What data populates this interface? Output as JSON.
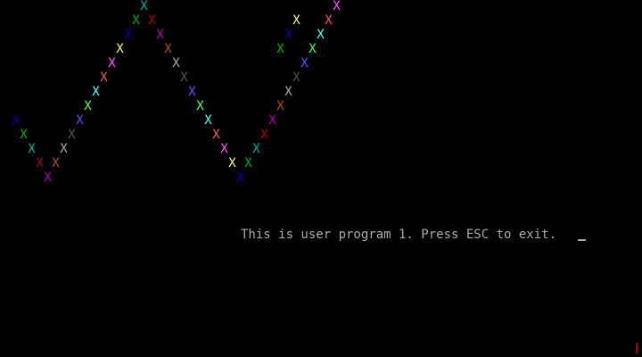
{
  "screen": {
    "message": "This is user program 1. Press ESC to exit.",
    "background_color": "#000000",
    "text_color": "#aaaaaa"
  },
  "pattern": {
    "glyph": "X",
    "marks": [
      {
        "col": 1,
        "row": 8,
        "color": "#0000aa"
      },
      {
        "col": 2,
        "row": 9,
        "color": "#00aa00"
      },
      {
        "col": 3,
        "row": 10,
        "color": "#00aaaa"
      },
      {
        "col": 4,
        "row": 11,
        "color": "#aa0000"
      },
      {
        "col": 5,
        "row": 12,
        "color": "#aa00aa"
      },
      {
        "col": 6,
        "row": 11,
        "color": "#aa5500"
      },
      {
        "col": 7,
        "row": 10,
        "color": "#aaaaaa"
      },
      {
        "col": 8,
        "row": 9,
        "color": "#555555"
      },
      {
        "col": 9,
        "row": 8,
        "color": "#5555ff"
      },
      {
        "col": 10,
        "row": 7,
        "color": "#55ff55"
      },
      {
        "col": 11,
        "row": 6,
        "color": "#55ffff"
      },
      {
        "col": 12,
        "row": 5,
        "color": "#ff5555"
      },
      {
        "col": 13,
        "row": 4,
        "color": "#ff55ff"
      },
      {
        "col": 14,
        "row": 3,
        "color": "#ffff55"
      },
      {
        "col": 15,
        "row": 2,
        "color": "#0000aa"
      },
      {
        "col": 16,
        "row": 1,
        "color": "#00aa00"
      },
      {
        "col": 17,
        "row": 0,
        "color": "#00aaaa"
      },
      {
        "col": 18,
        "row": 1,
        "color": "#aa0000"
      },
      {
        "col": 19,
        "row": 2,
        "color": "#aa00aa"
      },
      {
        "col": 20,
        "row": 3,
        "color": "#aa5500"
      },
      {
        "col": 21,
        "row": 4,
        "color": "#aaaaaa"
      },
      {
        "col": 22,
        "row": 5,
        "color": "#555555"
      },
      {
        "col": 23,
        "row": 6,
        "color": "#5555ff"
      },
      {
        "col": 24,
        "row": 7,
        "color": "#55ff55"
      },
      {
        "col": 25,
        "row": 8,
        "color": "#55ffff"
      },
      {
        "col": 26,
        "row": 9,
        "color": "#ff5555"
      },
      {
        "col": 27,
        "row": 10,
        "color": "#ff55ff"
      },
      {
        "col": 28,
        "row": 11,
        "color": "#ffff55"
      },
      {
        "col": 29,
        "row": 12,
        "color": "#0000aa"
      },
      {
        "col": 30,
        "row": 11,
        "color": "#00aa00"
      },
      {
        "col": 31,
        "row": 10,
        "color": "#00aaaa"
      },
      {
        "col": 32,
        "row": 9,
        "color": "#aa0000"
      },
      {
        "col": 33,
        "row": 8,
        "color": "#aa00aa"
      },
      {
        "col": 34,
        "row": 7,
        "color": "#aa5500"
      },
      {
        "col": 35,
        "row": 6,
        "color": "#aaaaaa"
      },
      {
        "col": 36,
        "row": 5,
        "color": "#555555"
      },
      {
        "col": 37,
        "row": 4,
        "color": "#5555ff"
      },
      {
        "col": 38,
        "row": 3,
        "color": "#55ff55"
      },
      {
        "col": 39,
        "row": 2,
        "color": "#55ffff"
      },
      {
        "col": 40,
        "row": 1,
        "color": "#ff5555"
      },
      {
        "col": 41,
        "row": 0,
        "color": "#ff55ff"
      },
      {
        "col": 36,
        "row": 1,
        "color": "#ffff55"
      },
      {
        "col": 35,
        "row": 2,
        "color": "#0000aa"
      },
      {
        "col": 34,
        "row": 3,
        "color": "#00aa00"
      },
      {
        "col": 39,
        "row": 2,
        "color": "#00ffff"
      }
    ]
  },
  "cursor": {
    "visible": true,
    "color": "#aaaaaa"
  },
  "corner_mark": {
    "color": "#aa0000"
  }
}
